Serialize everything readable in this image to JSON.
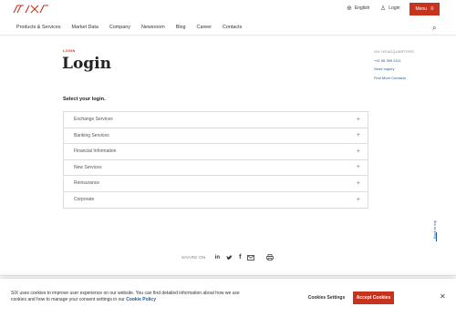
{
  "brand": {
    "logo_text": "SIX",
    "accent_color": "#c8331d",
    "link_color": "#1a5a9a"
  },
  "topbar": {
    "language_icon": "globe-icon",
    "language_label": "English",
    "login_icon": "user-icon",
    "login_label": "Login",
    "menu_label": "Menu",
    "menu_icon": "hamburger-icon"
  },
  "nav": {
    "items": [
      "Products & Services",
      "Market Data",
      "Company",
      "Newsroom",
      "Blog",
      "Career",
      "Contacts"
    ],
    "search_icon": "search-icon"
  },
  "main": {
    "eyebrow": "LOGIN",
    "title": "Login",
    "subhead": "Select your login.",
    "accordion": [
      {
        "label": "Exchange Services"
      },
      {
        "label": "Banking Services"
      },
      {
        "label": "Financial Information"
      },
      {
        "label": "New Services"
      },
      {
        "label": "Reinsurance"
      },
      {
        "label": "Corporate"
      }
    ]
  },
  "sidebar": {
    "label": "SIX HEADQUARTERS",
    "phone": "+41 58 399 2111",
    "send_inquiry": "Send Inquiry",
    "find_more": "Find More Contacts"
  },
  "share": {
    "label": "SHARE ON",
    "icons": [
      "linkedin-icon",
      "twitter-icon",
      "facebook-icon",
      "email-icon",
      "print-icon"
    ]
  },
  "back_to_top": "Back to top",
  "cookie": {
    "text": "SIX uses cookies to improve user experience on our website. You can find detailed information about how we use cookies and how to manage your consent settings in our",
    "policy_link": "Cookie Policy",
    "settings_label": "Cookies Settings",
    "accept_label": "Accept Cookies",
    "close_icon": "close-icon"
  }
}
